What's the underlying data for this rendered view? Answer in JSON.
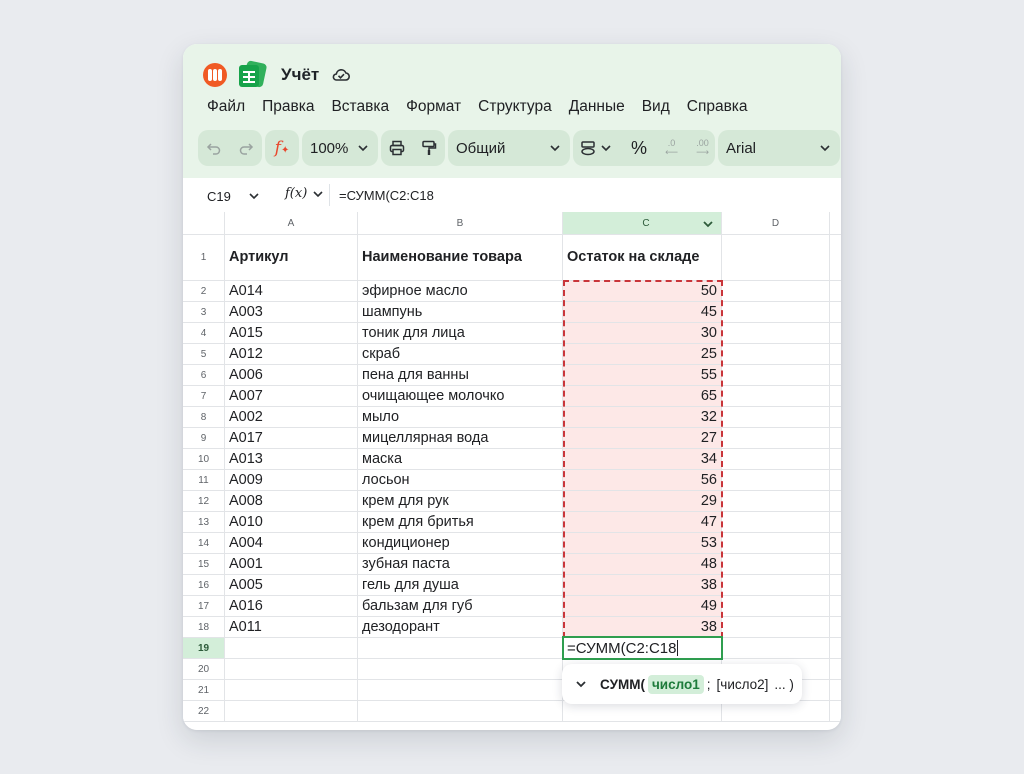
{
  "app": {
    "title": "Учёт",
    "menu": [
      "Файл",
      "Правка",
      "Вставка",
      "Формат",
      "Структура",
      "Данные",
      "Вид",
      "Справка"
    ]
  },
  "toolbar": {
    "zoom": "100%",
    "number_format": "Общий",
    "percent": "%",
    "decrease_decimals": ".0",
    "increase_decimals": ".00",
    "font": "Arial",
    "fx_icon_text": "f"
  },
  "formula_bar": {
    "cell_ref": "C19",
    "fx_label": "f(x)",
    "formula": "=СУММ(C2:C18"
  },
  "sheet": {
    "columns": [
      "A",
      "B",
      "C",
      "D"
    ],
    "row_numbers": [
      "1",
      "2",
      "3",
      "4",
      "5",
      "6",
      "7",
      "8",
      "9",
      "10",
      "11",
      "12",
      "13",
      "14",
      "15",
      "16",
      "17",
      "18",
      "19",
      "20",
      "21",
      "22"
    ],
    "headers": [
      "Артикул",
      "Наименование товара",
      "Остаток на складе"
    ],
    "rows": [
      [
        "A014",
        "эфирное масло",
        "50"
      ],
      [
        "A003",
        "шампунь",
        "45"
      ],
      [
        "A015",
        "тоник для лица",
        "30"
      ],
      [
        "A012",
        "скраб",
        "25"
      ],
      [
        "A006",
        "пена для ванны",
        "55"
      ],
      [
        "A007",
        "очищающее молочко",
        "65"
      ],
      [
        "A002",
        "мыло",
        "32"
      ],
      [
        "A017",
        "мицеллярная вода",
        "27"
      ],
      [
        "A013",
        "маска",
        "34"
      ],
      [
        "A009",
        "лосьон",
        "56"
      ],
      [
        "A008",
        "крем для рук",
        "29"
      ],
      [
        "A010",
        "крем для бритья",
        "47"
      ],
      [
        "A004",
        "кондиционер",
        "53"
      ],
      [
        "A001",
        "зубная паста",
        "48"
      ],
      [
        "A005",
        "гель для душа",
        "38"
      ],
      [
        "A016",
        "бальзам для губ",
        "49"
      ],
      [
        "A011",
        "дезодорант",
        "38"
      ]
    ],
    "active_cell_text": "=СУММ(C2:C18",
    "selected_column": "C",
    "active_row": "19"
  },
  "hint": {
    "function_name": "СУММ(",
    "arg1": "число1",
    "separator": ";",
    "arg2": "[число2]",
    "tail": "... )"
  },
  "colors": {
    "topbar_bg": "#e8f4e9",
    "range_fill": "#fde8e7",
    "range_border": "#c9353a",
    "active_border": "#2f9e4f",
    "logo": "#f05a24",
    "app_icon": "#17a34a"
  }
}
